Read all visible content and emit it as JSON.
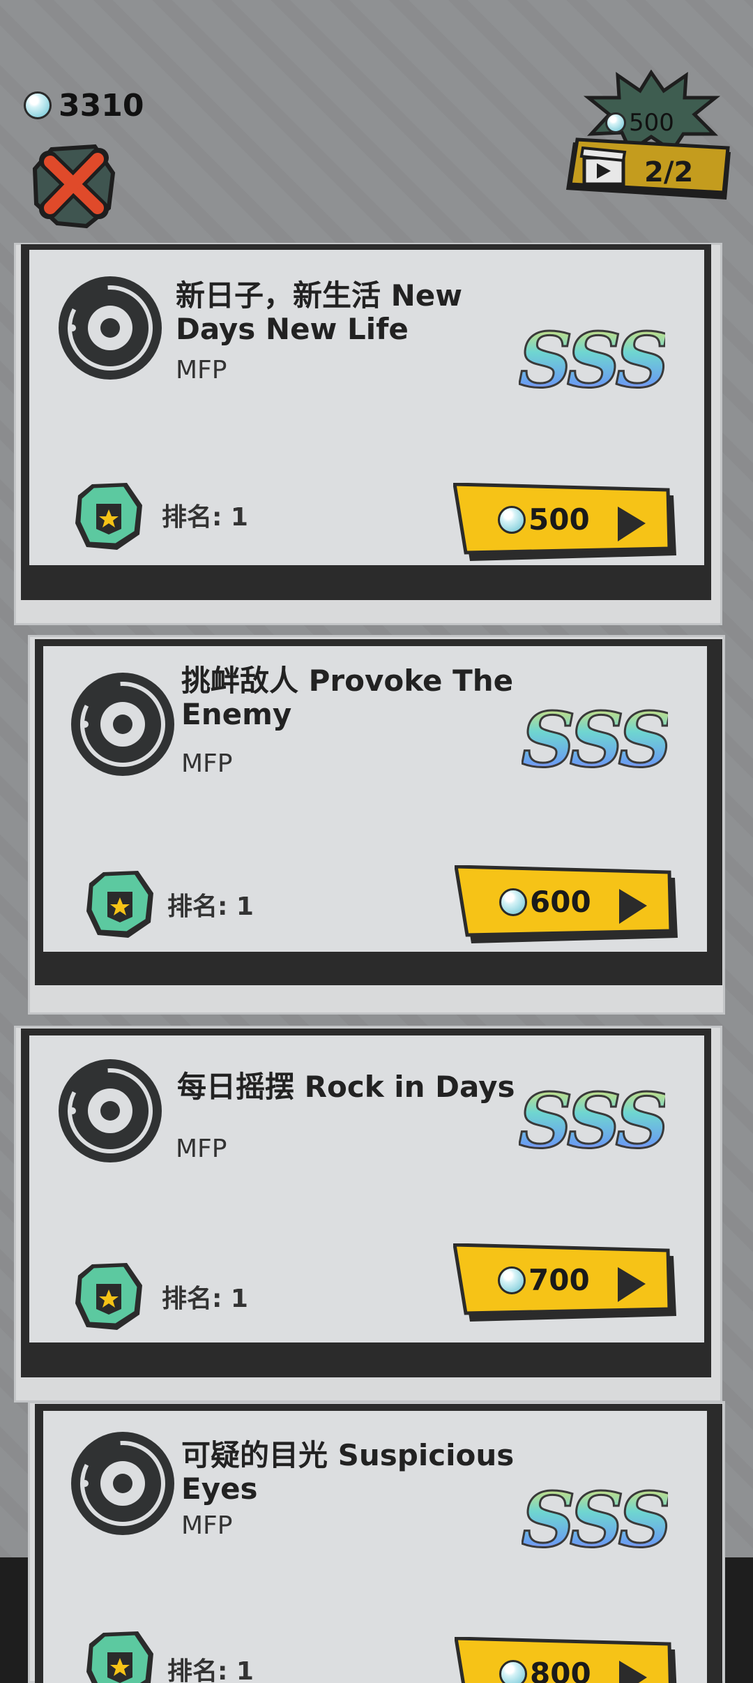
{
  "currency": {
    "value": "3310"
  },
  "reward": {
    "amount": "500",
    "count": "2/2"
  },
  "songs": [
    {
      "title_line1": "新日子，新生活 New",
      "title_line2": "Days New Life",
      "artist": "MFP",
      "grade": "SSS",
      "rank_label": "排名: 1",
      "price": "500"
    },
    {
      "title_line1": "挑衅敌人 Provoke The",
      "title_line2": "Enemy",
      "artist": "MFP",
      "grade": "SSS",
      "rank_label": "排名: 1",
      "price": "600"
    },
    {
      "title_line1": "每日摇摆 Rock in Days",
      "title_line2": "",
      "artist": "MFP",
      "grade": "SSS",
      "rank_label": "排名: 1",
      "price": "700"
    },
    {
      "title_line1": "可疑的目光 Suspicious",
      "title_line2": "Eyes",
      "artist": "MFP",
      "grade": "SSS",
      "rank_label": "排名: 1",
      "price": "800"
    }
  ],
  "colors": {
    "button_yellow": "#f6c317",
    "badge_teal": "#5cc9a0",
    "close_red": "#e04a2a",
    "burst_green": "#3e5d50",
    "ticket_gold": "#c49c1e"
  },
  "icons": [
    "gem-icon",
    "close-icon",
    "disc-icon",
    "rank-badge-icon",
    "play-arrow-icon",
    "ticket-icon"
  ]
}
